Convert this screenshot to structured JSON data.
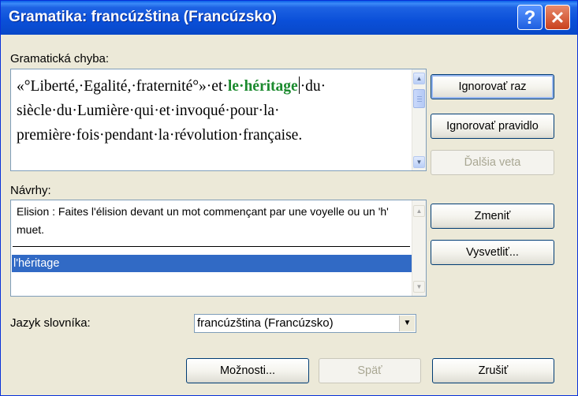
{
  "title": "Gramatika: francúzština (Francúzsko)",
  "titlebar_buttons": {
    "help": "?",
    "close": "✕"
  },
  "error_section": {
    "label": "Gramatická chyba:",
    "text_before": "«°Liberté,·Egalité,·fraternité°»·et·",
    "highlighted": "le·héritage",
    "text_after": "·du· siècle·du·Lumière·qui·et·invoqué·pour·la· première·fois·pendant·la·révolution·française."
  },
  "suggestions_section": {
    "label": "Návrhy:",
    "explanation": "Elision : Faites l'élision devant un mot commençant par une voyelle ou un 'h' muet.",
    "items": [
      "l'héritage"
    ]
  },
  "dictionary": {
    "label": "Jazyk slovníka:",
    "value": "francúzština (Francúzsko)"
  },
  "buttons": {
    "ignore_once": "Ignorovať raz",
    "ignore_rule": "Ignorovať pravidlo",
    "next_sentence": "Ďalšia veta",
    "change": "Zmeniť",
    "explain": "Vysvetliť...",
    "options": "Možnosti...",
    "back": "Späť",
    "cancel": "Zrušiť"
  },
  "colors": {
    "titlebar": "#0a4fd8",
    "window_bg": "#ece9d8",
    "highlight_green": "#1b8a2e",
    "selection": "#316ac5"
  }
}
